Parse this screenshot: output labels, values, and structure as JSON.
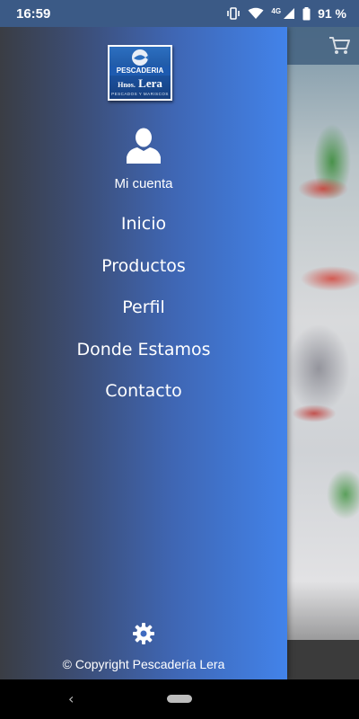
{
  "status_bar": {
    "time": "16:59",
    "network_label": "4G",
    "battery_text": "91 %",
    "icons": [
      "vibrate-icon",
      "wifi-icon",
      "signal-icon",
      "battery-icon"
    ]
  },
  "logo": {
    "ribbon_text": "PESCADERIA",
    "brand_prefix": "Hnos.",
    "brand_name": "Lera",
    "tagline": "PESCADOS Y MARISCOS"
  },
  "account": {
    "icon": "user-icon",
    "label": "Mi cuenta"
  },
  "menu": {
    "items": [
      {
        "label": "Inicio"
      },
      {
        "label": "Productos"
      },
      {
        "label": "Perfil"
      },
      {
        "label": "Donde Estamos"
      },
      {
        "label": "Contacto"
      }
    ]
  },
  "footer": {
    "settings_icon": "gear-icon",
    "copyright": "© Copyright Pescadería Lera"
  },
  "background": {
    "cart_icon": "cart-icon"
  },
  "nav_bar": {
    "back_glyph": "‹"
  },
  "colors": {
    "drawer_gradient_start": "#3a3d44",
    "drawer_gradient_end": "#4283ea",
    "status_bar": "#3b5a86",
    "text": "#ffffff"
  }
}
